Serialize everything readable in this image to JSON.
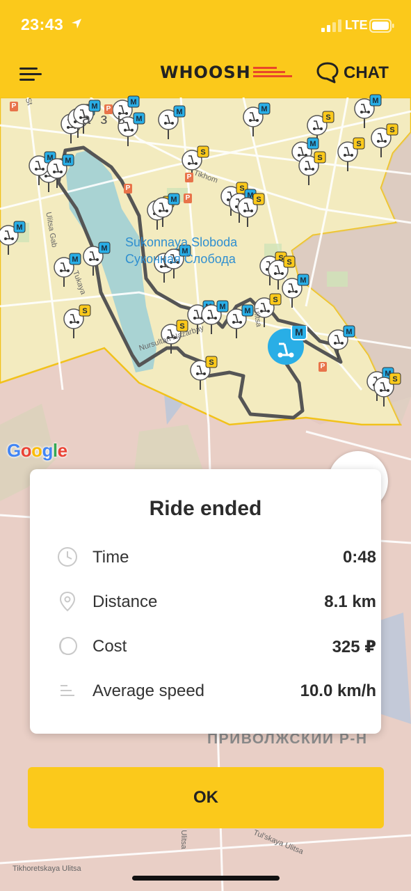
{
  "status_bar": {
    "time": "23:43",
    "network": "LTE"
  },
  "header": {
    "logo": "WHOOSH",
    "chat_label": "CHAT"
  },
  "map": {
    "district_label": "Sukonnaya Sloboda",
    "district_label_ru": "Суконная Слобода",
    "city_fragment": "а з   ь",
    "region_label": "ПРИВОЛЖСКИЙ Р-Н",
    "provider": "Google",
    "streets": {
      "tikhomirnova": "Tikhom",
      "ulitsa_gab": "Ulitsa Gab",
      "tukaya": "Tukaya",
      "nazarbay": "Nursultan Nazarbay",
      "tulskaya": "Tul'skaya Ulitsa",
      "tikhoretskaya": "Tikhoretskaya Ulitsa",
      "ulitsa": "Ulitsa",
      "st": "St"
    },
    "scooter_badges": {
      "m": "M",
      "s": "S"
    },
    "parking_marker": "P"
  },
  "ride_summary": {
    "title": "Ride ended",
    "rows": [
      {
        "label": "Time",
        "value": "0:48",
        "icon": "clock-icon"
      },
      {
        "label": "Distance",
        "value": "8.1 km",
        "icon": "location-pin-icon"
      },
      {
        "label": "Cost",
        "value": "325 ₽",
        "icon": "coin-icon"
      },
      {
        "label": "Average speed",
        "value": "10.0 km/h",
        "icon": "speed-lines-icon"
      }
    ]
  },
  "ok_button": {
    "label": "OK"
  },
  "colors": {
    "brand_yellow": "#fbc91b",
    "scooter_blue": "#29aee6",
    "route_gray": "#555555"
  }
}
